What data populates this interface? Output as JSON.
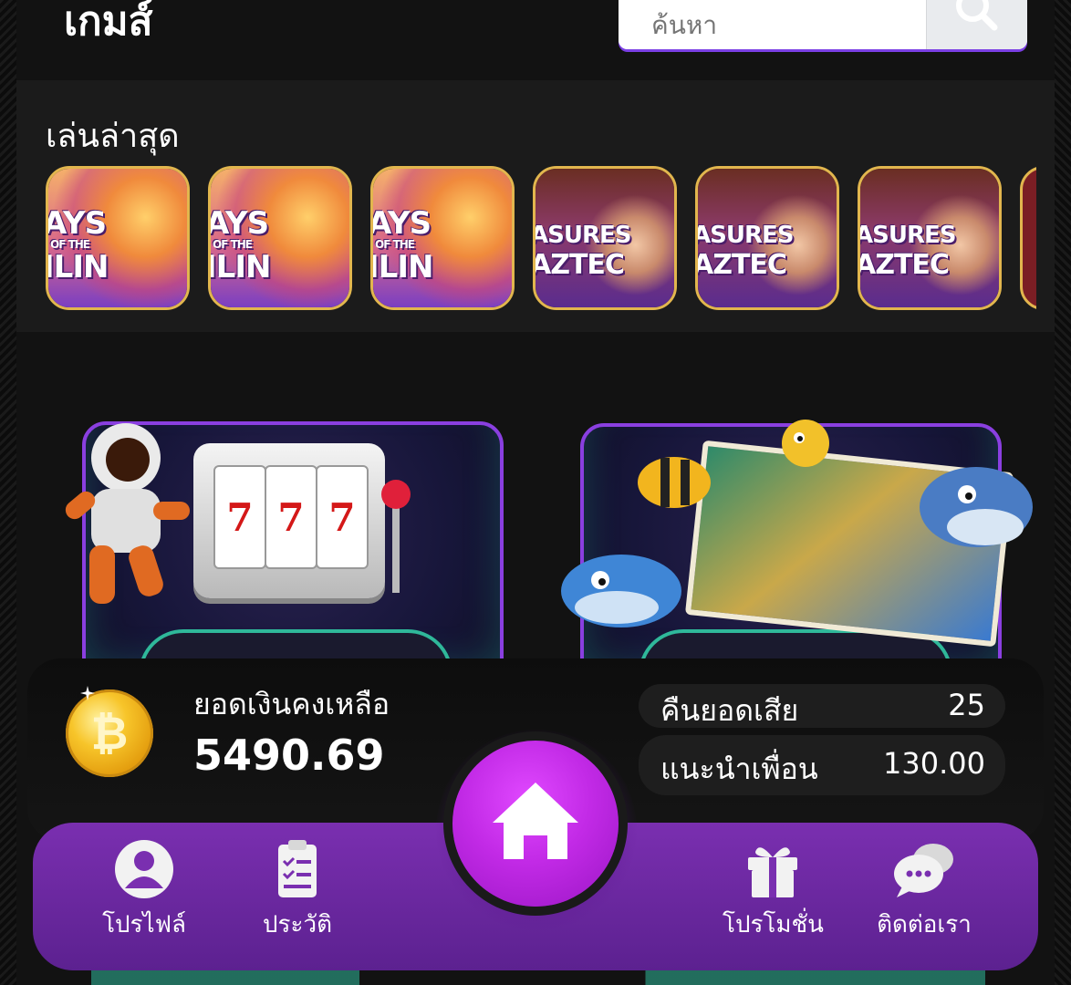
{
  "header": {
    "title": "เกมส์",
    "search_placeholder": "ค้นหา"
  },
  "recent": {
    "title": "เล่นล่าสุด",
    "games": [
      {
        "kind": "qilin",
        "line1": "AYS",
        "line2": "OF THE",
        "line3": "ILIN"
      },
      {
        "kind": "qilin",
        "line1": "AYS",
        "line2": "OF THE",
        "line3": "ILIN"
      },
      {
        "kind": "qilin",
        "line1": "AYS",
        "line2": "OF THE",
        "line3": "ILIN"
      },
      {
        "kind": "aztec",
        "line1": "ASURES",
        "line2": "AZTEC"
      },
      {
        "kind": "aztec",
        "line1": "ASURES",
        "line2": "AZTEC"
      },
      {
        "kind": "aztec",
        "line1": "ASURES",
        "line2": "AZTEC"
      }
    ]
  },
  "slot_reels": [
    "7",
    "7",
    "7"
  ],
  "wallet": {
    "balance_label": "ยอดเงินคงเหลือ",
    "balance_value": "5490.69",
    "coin_symbol": "₿",
    "stats": [
      {
        "label": "คืนยอดเสีย",
        "value": "25"
      },
      {
        "label": "แนะนำเพื่อน",
        "value": "130.00"
      }
    ]
  },
  "nav": {
    "profile": "โปรไฟล์",
    "history": "ประวัติ",
    "promotion": "โปรโมชั่น",
    "contact": "ติดต่อเรา"
  },
  "colors": {
    "accent_purple": "#8a3fe0",
    "nav_purple": "#6a27a2",
    "home_magenta": "#c22ae6",
    "tile_gold": "#e2b64e",
    "teal": "#2fb89a"
  }
}
